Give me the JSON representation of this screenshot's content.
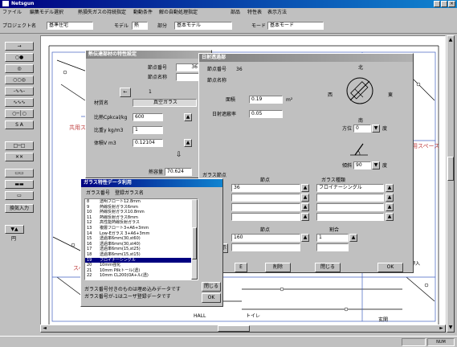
{
  "app": {
    "title": "Netsgun"
  },
  "menu": [
    "ファイル",
    "編集モデル選択",
    "熱損失ガスの持続指定",
    "動動条件",
    "解の自動処理指定",
    "部品",
    "特性表",
    "表示方法"
  ],
  "toolbar": {
    "project_label": "プロジェクト名",
    "project_value": "基準住宅",
    "model_label": "モデル",
    "model_value": "熱",
    "part_label": "部分",
    "part_value": "基本モデル",
    "mode_label": "モード",
    "mode_value": "基本モード"
  },
  "tools": [
    "→",
    "○●",
    "◎",
    "○○◎",
    "-∿∿-",
    "∿∿∿",
    "○─│○",
    "S A",
    "□─□",
    "✕✕",
    "▭▭",
    "▬▬",
    "▭",
    "換気入力",
    "▼▲",
    "円"
  ],
  "dialog1": {
    "title": "熱伝達部材の特性設定",
    "node_no_label": "節点番号",
    "node_no_value": "36",
    "node_name_label": "節点名称",
    "node_name_value": "",
    "nav_value": "1",
    "material_label": "材質名",
    "material_value": "真空ガラス",
    "specific_heat_label": "比熱Cpkcal/kg",
    "specific_heat_value": "600",
    "specific_gravity_label": "比重γ kg/m3",
    "specific_gravity_value": "1",
    "volume_label": "体積V m3",
    "volume_value": "0.12104",
    "heat_capacity_label": "熱容量",
    "heat_capacity_value": "70.624"
  },
  "dialog2": {
    "title": "日射透過部",
    "node_no_label": "節点番号",
    "node_no_value": "36",
    "node_name_label": "節点名称",
    "area_label": "面積",
    "area_value": "0.19",
    "area_unit": "m²",
    "shading_label": "日射遮蔽率",
    "shading_value": "0.05",
    "compass_north": "北",
    "compass_south": "南",
    "compass_east": "東",
    "compass_west": "西",
    "azimuth_label": "方位",
    "azimuth_value": "0",
    "azimuth_unit": "度",
    "tilt_label": "傾斜",
    "tilt_value": "90",
    "tilt_unit": "度",
    "glass_node_label": "ガラス節点",
    "col_node": "節点",
    "col_glass_type": "ガラス種類",
    "glass_rows": [
      {
        "node": "36",
        "type": "フロイナーシングル"
      },
      {
        "node": "",
        "type": ""
      },
      {
        "node": "",
        "type": ""
      },
      {
        "node": "",
        "type": ""
      }
    ],
    "col_node2": "節点",
    "col_ratio": "割合",
    "ratio_rows": [
      {
        "node": "160",
        "ratio": "1"
      },
      {
        "node": "",
        "ratio": ""
      }
    ],
    "glass_display_button": "ガラス表示",
    "delete_button": "削除",
    "close_button": "閉じる",
    "ok_button": "OK",
    "e_button": "E"
  },
  "dialog3": {
    "title": "ガラス特性データ利用",
    "col_no": "ガラス番号",
    "col_name": "登録ガラス名",
    "items": [
      {
        "no": "8",
        "name": "透明フロート12.8mm"
      },
      {
        "no": "9",
        "name": "熱線反射ガラス6mm"
      },
      {
        "no": "10",
        "name": "熱線反射ガラス10.8mm"
      },
      {
        "no": "11",
        "name": "熱線反射ガラス8mm"
      },
      {
        "no": "12",
        "name": "高性能熱線反射ガラス"
      },
      {
        "no": "13",
        "name": "複層フロート3+A6+3mm"
      },
      {
        "no": "14",
        "name": "Low-Eガラス 3+A6+3mm"
      },
      {
        "no": "15",
        "name": "透過率6mm(30,st60)"
      },
      {
        "no": "16",
        "name": "透過率6mm(30,st40)"
      },
      {
        "no": "17",
        "name": "透過率6mm(15,st25)"
      },
      {
        "no": "18",
        "name": "透過率6mm(15,st15)"
      },
      {
        "no": "19",
        "name": "フロイナーシングル"
      },
      {
        "no": "20",
        "name": "10mm強化"
      },
      {
        "no": "21",
        "name": "10mm Pilkトール(透)"
      },
      {
        "no": "22",
        "name": "10mm CL200(OA+ル(透)"
      }
    ],
    "selected_index": 11,
    "note1": "ガラス番号付きのものは埋め込みデータです",
    "note2": "ガラス番号が-1はユーザ登録データです",
    "close_button": "閉じる",
    "ok_button": "OK"
  },
  "canvas_labels": [
    "共用スペース",
    "共用スペース",
    "押入",
    "スペース",
    "押入",
    "トイレ",
    "玄関",
    "HALL"
  ],
  "status": {
    "num": "NUM"
  }
}
